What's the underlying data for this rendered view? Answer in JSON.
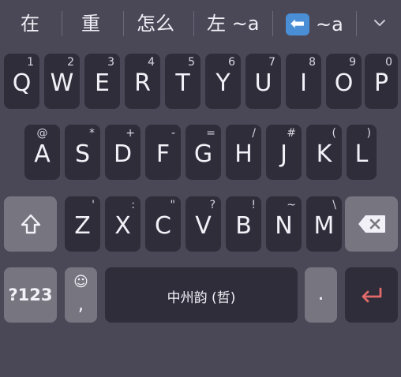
{
  "candidates": {
    "c1": "在",
    "c2": "重",
    "c3": "怎么",
    "c4": "左 ~a",
    "c5_emoji": "⬅",
    "c5_text": "~a"
  },
  "rows": {
    "row1": [
      {
        "key": "Q",
        "hint": "1"
      },
      {
        "key": "W",
        "hint": "2"
      },
      {
        "key": "E",
        "hint": "3"
      },
      {
        "key": "R",
        "hint": "4"
      },
      {
        "key": "T",
        "hint": "5"
      },
      {
        "key": "Y",
        "hint": "6"
      },
      {
        "key": "U",
        "hint": "7"
      },
      {
        "key": "I",
        "hint": "8"
      },
      {
        "key": "O",
        "hint": "9"
      },
      {
        "key": "P",
        "hint": "0"
      }
    ],
    "row2": [
      {
        "key": "A",
        "hint": "@"
      },
      {
        "key": "S",
        "hint": "*"
      },
      {
        "key": "D",
        "hint": "+"
      },
      {
        "key": "F",
        "hint": "-"
      },
      {
        "key": "G",
        "hint": "="
      },
      {
        "key": "H",
        "hint": "/"
      },
      {
        "key": "J",
        "hint": "#"
      },
      {
        "key": "K",
        "hint": "("
      },
      {
        "key": "L",
        "hint": ")"
      }
    ],
    "row3": [
      {
        "key": "Z",
        "hint": "'"
      },
      {
        "key": "X",
        "hint": ":"
      },
      {
        "key": "C",
        "hint": "\""
      },
      {
        "key": "V",
        "hint": "?"
      },
      {
        "key": "B",
        "hint": "!"
      },
      {
        "key": "N",
        "hint": "~"
      },
      {
        "key": "M",
        "hint": "\\"
      }
    ]
  },
  "bottom": {
    "symbols_label": "?123",
    "emoji_glyph": "☺",
    "comma": ",",
    "space_label": "中州韵 (哲)",
    "period": "."
  },
  "colors": {
    "background": "#4a4857",
    "key": "#2f2d3a",
    "func_key": "#777580",
    "enter_accent": "#e06a6a"
  }
}
